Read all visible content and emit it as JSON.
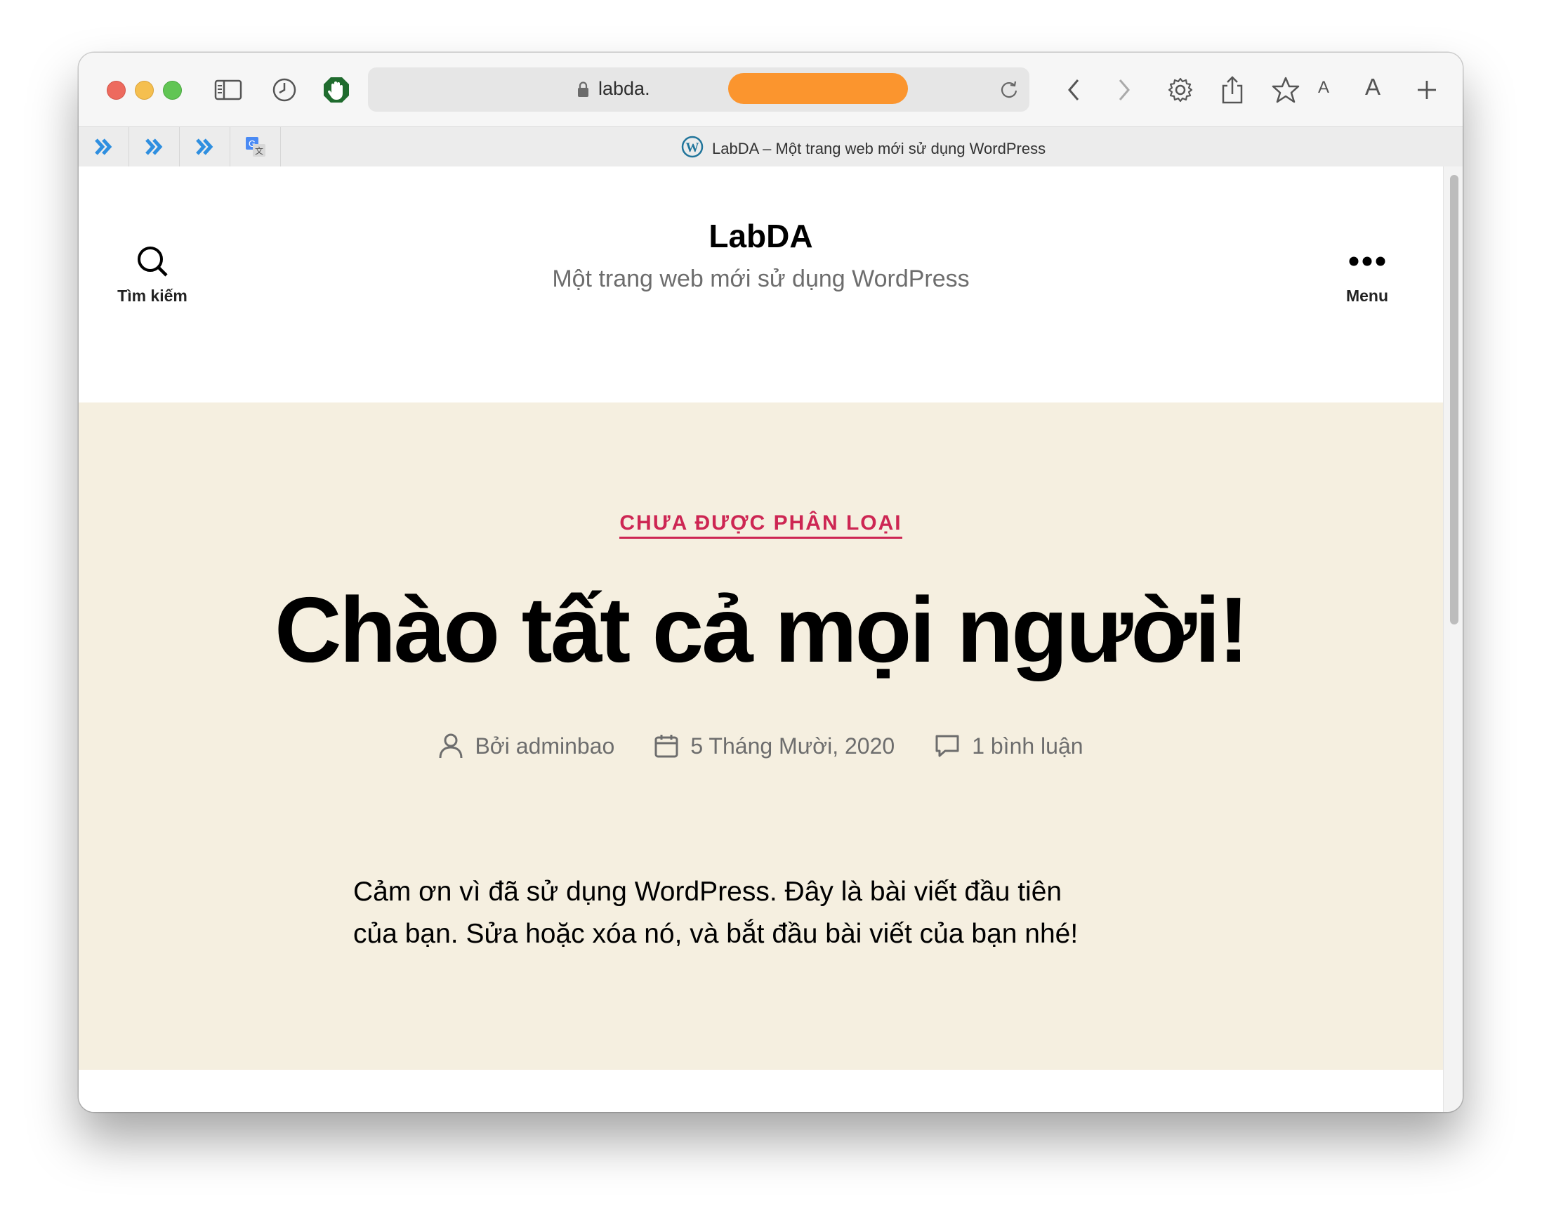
{
  "browser": {
    "address": "labda.",
    "tab_title": "LabDA – Một trang web mới sử dụng WordPress",
    "font_small_label": "A",
    "font_large_label": "A",
    "redaction_color": "#fb952e"
  },
  "site": {
    "title": "LabDA",
    "description": "Một trang web mới sử dụng WordPress",
    "search_label": "Tìm kiếm",
    "menu_label": "Menu"
  },
  "post": {
    "category": "CHƯA ĐƯỢC PHÂN LOẠI",
    "title": "Chào tất cả mọi người!",
    "author": "Bởi adminbao",
    "date": "5 Tháng Mười, 2020",
    "comments": "1 bình luận",
    "body_line1": "Cảm ơn vì đã sử dụng WordPress. Đây là bài viết đầu tiên",
    "body_line2": "của bạn. Sửa hoặc xóa nó, và bắt đầu bài viết của bạn nhé!"
  },
  "colors": {
    "hero_background": "#f5efe0",
    "accent": "#cd2653",
    "meta_text": "#6d6d6d"
  }
}
